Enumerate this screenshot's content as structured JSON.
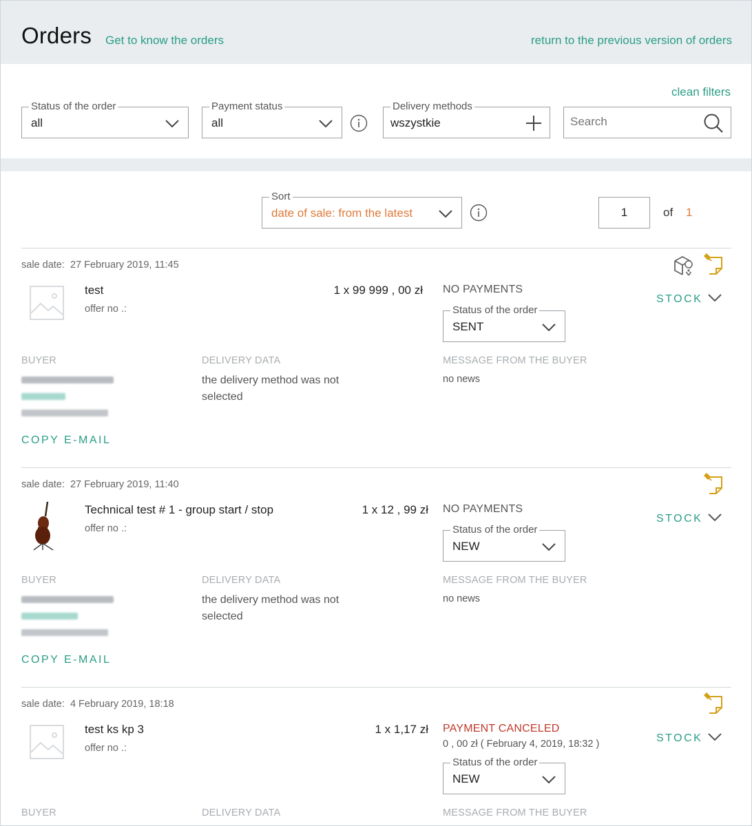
{
  "header": {
    "title": "Orders",
    "know_link": "Get to know the orders",
    "return_link": "return to the previous version of orders"
  },
  "filters": {
    "clean": "clean filters",
    "order_status": {
      "label": "Status of the order",
      "value": "all"
    },
    "payment_status": {
      "label": "Payment status",
      "value": "all"
    },
    "delivery": {
      "label": "Delivery methods",
      "value": "wszystkie"
    },
    "search": {
      "placeholder": "Search"
    }
  },
  "sort": {
    "label": "Sort",
    "value": "date of sale: from the latest"
  },
  "pagination": {
    "current": "1",
    "of": "of",
    "total": "1"
  },
  "colors": {
    "accent": "#2a9d86",
    "orange": "#e07a3a",
    "note_icon": "#d4a017",
    "cancel": "#c0392b"
  },
  "labels": {
    "sale_date": "sale date:",
    "offer_no": "offer no .:",
    "status": "Status of the order",
    "buyer": "BUYER",
    "delivery": "DELIVERY DATA",
    "message": "MESSAGE FROM THE BUYER",
    "copy_email": "COPY E-MAIL",
    "stock": "STOCK",
    "no_delivery": "the delivery method was not selected",
    "no_news": "no news"
  },
  "orders": [
    {
      "sale_date": "27 February 2019, 11:45",
      "product": "test",
      "price": "1 x 99  999 , 00 zł",
      "payment": "NO PAYMENTS",
      "status": "SENT",
      "icons": [
        "parcel-location-icon",
        "note-pin-icon"
      ]
    },
    {
      "sale_date": "27 February 2019, 11:40",
      "product": "Technical test # 1 - group start / stop",
      "price": "1 x 12 , 99 zł",
      "payment": "NO PAYMENTS",
      "status": "NEW",
      "icons": [
        "note-pin-icon"
      ]
    },
    {
      "sale_date": "4 February 2019, 18:18",
      "product": "test ks kp 3",
      "price": "1 x 1,17 zł",
      "payment": "PAYMENT CANCELED",
      "payment_detail": "0 , 00 zł  ( February 4, 2019, 18:32 )",
      "status": "NEW",
      "icons": [
        "note-pin-icon"
      ]
    }
  ]
}
